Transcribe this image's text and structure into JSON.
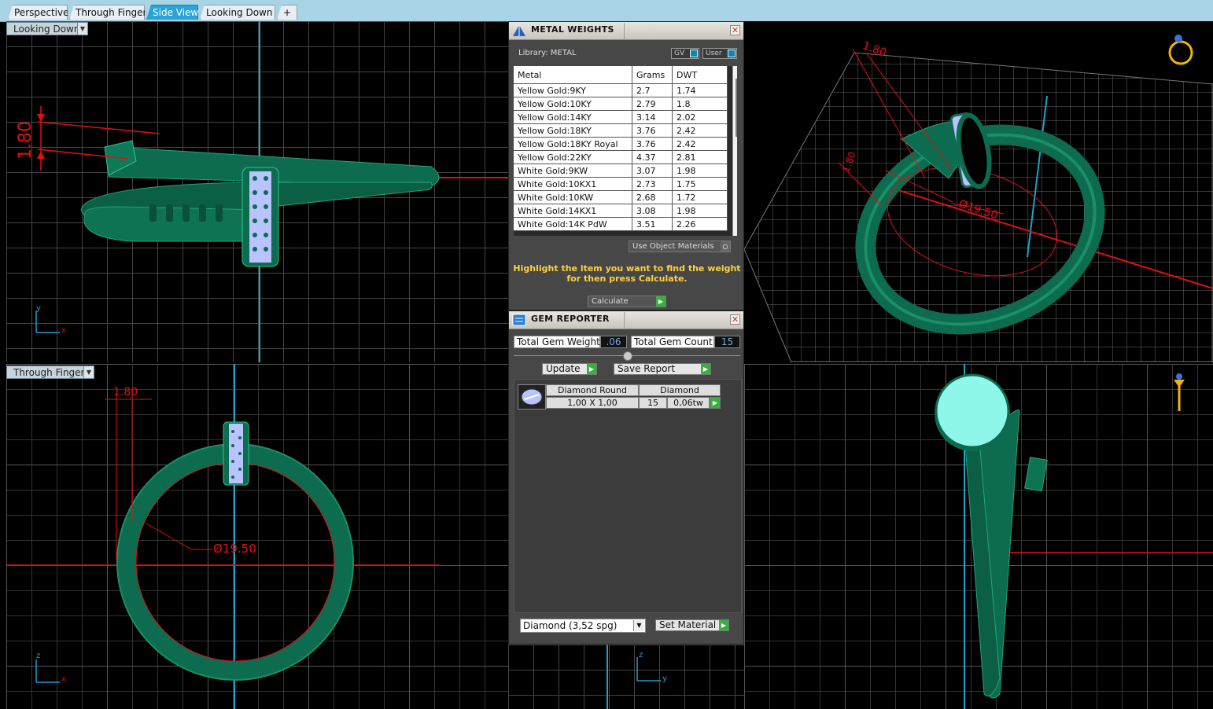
{
  "tabs": [
    "Perspective",
    "Through Finger",
    "Side View",
    "Looking Down",
    "+"
  ],
  "active_tab": "Side View",
  "viewports": {
    "top_left": {
      "label": "Looking Down",
      "dim_text": "1.80",
      "axis_v": "y",
      "axis_h": "x"
    },
    "top_right": {
      "dim_text": "1.80",
      "dim_text_2": "1.80",
      "diameter_text": "Ø19.50"
    },
    "bottom_left": {
      "label": "Through Finger",
      "dim_text": "1.80",
      "diameter_text": "Ø19.50",
      "axis_v": "z",
      "axis_h": "x"
    },
    "bottom_middle": {
      "axis_v": "z",
      "axis_h": "y"
    },
    "bottom_right": {}
  },
  "metal_weights": {
    "title": "METAL WEIGHTS",
    "library_label": "Library: METAL",
    "toggle_gv": "GV",
    "toggle_user": "User",
    "columns": [
      "Metal",
      "Grams",
      "DWT"
    ],
    "rows": [
      [
        "Yellow Gold:9KY",
        "2.7",
        "1.74"
      ],
      [
        "Yellow Gold:10KY",
        "2.79",
        "1.8"
      ],
      [
        "Yellow Gold:14KY",
        "3.14",
        "2.02"
      ],
      [
        "Yellow Gold:18KY",
        "3.76",
        "2.42"
      ],
      [
        "Yellow Gold:18KY Royal",
        "3.76",
        "2.42"
      ],
      [
        "Yellow Gold:22KY",
        "4.37",
        "2.81"
      ],
      [
        "White Gold:9KW",
        "3.07",
        "1.98"
      ],
      [
        "White Gold:10KX1",
        "2.73",
        "1.75"
      ],
      [
        "White Gold:10KW",
        "2.68",
        "1.72"
      ],
      [
        "White Gold:14KX1",
        "3.08",
        "1.98"
      ],
      [
        "White Gold:14K PdW",
        "3.51",
        "2.26"
      ]
    ],
    "use_object_materials": "Use Object Materials",
    "hint": "Highlight the item you want to find the weight for then press Calculate.",
    "calculate": "Calculate"
  },
  "gem_reporter": {
    "title": "GEM REPORTER",
    "total_weight_label": "Total Gem Weight",
    "total_weight_value": ".06",
    "total_count_label": "Total Gem Count",
    "total_count_value": "15",
    "update": "Update",
    "save_report": "Save Report",
    "gem": {
      "shape": "Diamond Round",
      "material": "Diamond",
      "size": "1,00 X 1,00",
      "count": "15",
      "weight": "0,06tw"
    },
    "material_select": "Diamond      (3,52 spg)",
    "set_material": "Set Material"
  },
  "colors": {
    "band": "#0d6b4f",
    "band_light": "#1a8f68",
    "dimension": "#e01010",
    "axis_line": "#1aa6c6",
    "gem": "#b9c3ff"
  }
}
